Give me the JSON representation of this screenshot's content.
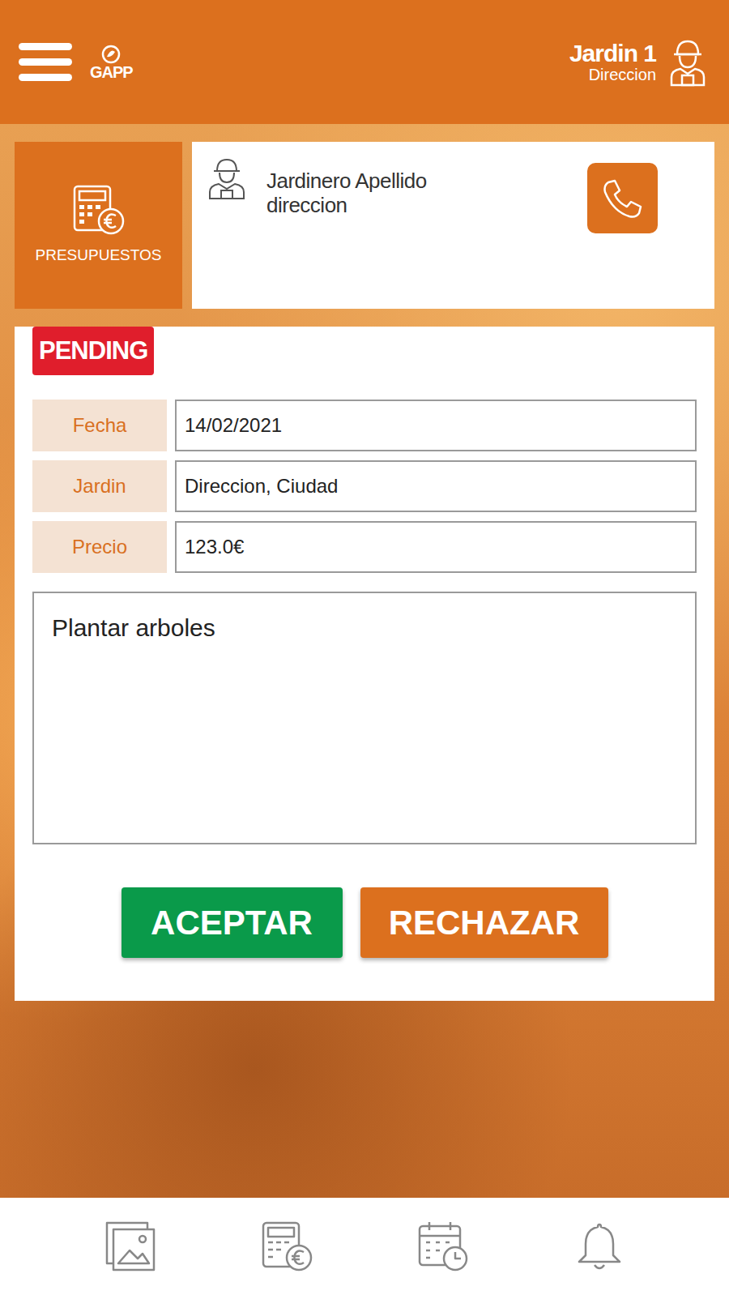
{
  "header": {
    "logo": "GAPP",
    "garden_name": "Jardin 1",
    "garden_address": "Direccion"
  },
  "section": {
    "label": "PRESUPUESTOS"
  },
  "gardener": {
    "name": "Jardinero Apellido",
    "address": "direccion"
  },
  "budget": {
    "status": "PENDING",
    "fields": [
      {
        "label": "Fecha",
        "value": "14/02/2021"
      },
      {
        "label": "Jardin",
        "value": "Direccion, Ciudad"
      },
      {
        "label": "Precio",
        "value": "123.0€"
      }
    ],
    "description": "Plantar arboles"
  },
  "buttons": [
    {
      "label": "ACEPTAR",
      "color": "#0a9a4a"
    },
    {
      "label": "RECHAZAR",
      "color": "#dc701e"
    }
  ],
  "bottom_nav": [
    {
      "kind": "gallery"
    },
    {
      "kind": "budgets"
    },
    {
      "kind": "calendar"
    },
    {
      "kind": "notifications"
    }
  ]
}
